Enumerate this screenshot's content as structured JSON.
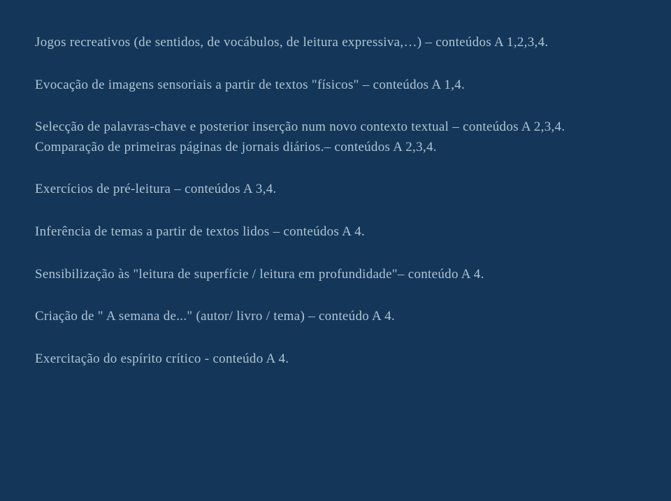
{
  "lines": {
    "l1": "Jogos recreativos (de sentidos, de vocábulos, de leitura expressiva,…) – conteúdos A 1,2,3,4.",
    "l2": "Evocação de imagens sensoriais a partir de textos \"físicos\" – conteúdos A 1,4.",
    "l3": "Selecção de palavras-chave e posterior inserção num novo contexto textual – conteúdos A 2,3,4.",
    "l4": "Comparação de primeiras páginas de jornais diários.– conteúdos A 2,3,4.",
    "l5": "Exercícios de pré-leitura – conteúdos A 3,4.",
    "l6": "Inferência de temas a partir de textos lidos – conteúdos A 4.",
    "l7": "Sensibilização às \"leitura de superfície / leitura em profundidade\"– conteúdo A 4.",
    "l8": "Criação de \" A semana de...\" (autor/ livro / tema) – conteúdo A 4.",
    "l9": "Exercitação do espírito crítico - conteúdo A 4."
  }
}
